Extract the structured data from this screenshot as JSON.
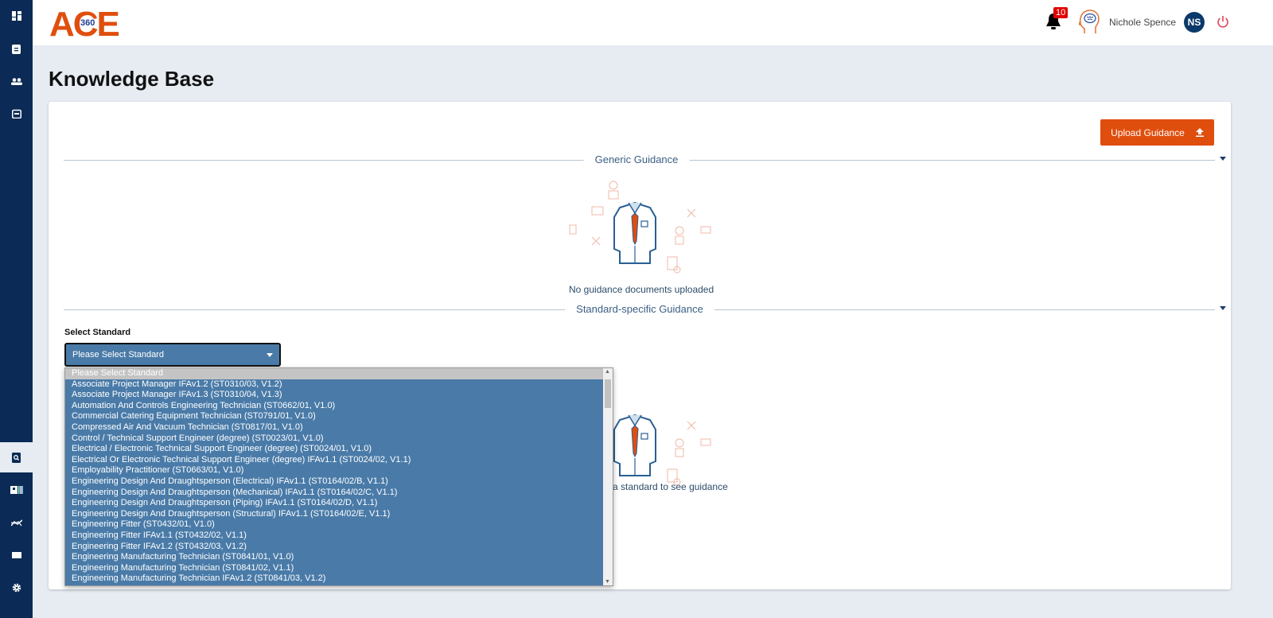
{
  "app": {
    "logo_text": "ACE",
    "logo_badge": "360"
  },
  "sidebar": {
    "items": [
      {
        "name": "dashboard"
      },
      {
        "name": "clipboard"
      },
      {
        "name": "users"
      },
      {
        "name": "calendar"
      },
      {
        "name": "knowledge-base",
        "active": true
      },
      {
        "name": "id-card"
      },
      {
        "name": "analytics"
      },
      {
        "name": "display"
      },
      {
        "name": "settings"
      }
    ]
  },
  "header": {
    "notifications": "10",
    "user_name": "Nichole Spence",
    "avatar_initials": "NS"
  },
  "page": {
    "title": "Knowledge Base"
  },
  "card": {
    "upload_label": "Upload Guidance",
    "generic_label": "Generic Guidance",
    "generic_empty": "No guidance documents uploaded",
    "standard_label": "Standard-specific Guidance",
    "select_label": "Select Standard",
    "select_value": "Please Select Standard",
    "standard_empty": "a standard to see guidance"
  },
  "dropdown": {
    "options": [
      "Please Select Standard",
      "Associate Project Manager IFAv1.2 (ST0310/03, V1.2)",
      "Associate Project Manager IFAv1.3 (ST0310/04, V1.3)",
      "Automation And Controls Engineering Technician (ST0662/01, V1.0)",
      "Commercial Catering Equipment Technician (ST0791/01, V1.0)",
      "Compressed Air And Vacuum Technician (ST0817/01, V1.0)",
      "Control / Technical Support Engineer (degree) (ST0023/01, V1.0)",
      "Electrical / Electronic Technical Support Engineer (degree) (ST0024/01, V1.0)",
      "Electrical Or Electronic Technical Support Engineer (degree) IFAv1.1 (ST0024/02, V1.1)",
      "Employability Practitioner (ST0663/01, V1.0)",
      "Engineering Design And Draughtsperson (Electrical) IFAv1.1 (ST0164/02/B, V1.1)",
      "Engineering Design And Draughtsperson (Mechanical) IFAv1.1 (ST0164/02/C, V1.1)",
      "Engineering Design And Draughtsperson (Piping) IFAv1.1 (ST0164/02/D, V1.1)",
      "Engineering Design And Draughtsperson (Structural) IFAv1.1 (ST0164/02/E, V1.1)",
      "Engineering Fitter (ST0432/01, V1.0)",
      "Engineering Fitter IFAv1.1 (ST0432/02, V1.1)",
      "Engineering Fitter IFAv1.2 (ST0432/03, V1.2)",
      "Engineering Manufacturing Technician (ST0841/01, V1.0)",
      "Engineering Manufacturing Technician (ST0841/02, V1.1)",
      "Engineering Manufacturing Technician IFAv1.2 (ST0841/03, V1.2)"
    ],
    "scroll_position": 0.05
  },
  "colors": {
    "sidebar": "#0b2a55",
    "accent": "#e04e0e",
    "select": "#4a7ba8",
    "badge": "#e00000",
    "power": "#e0405a"
  }
}
